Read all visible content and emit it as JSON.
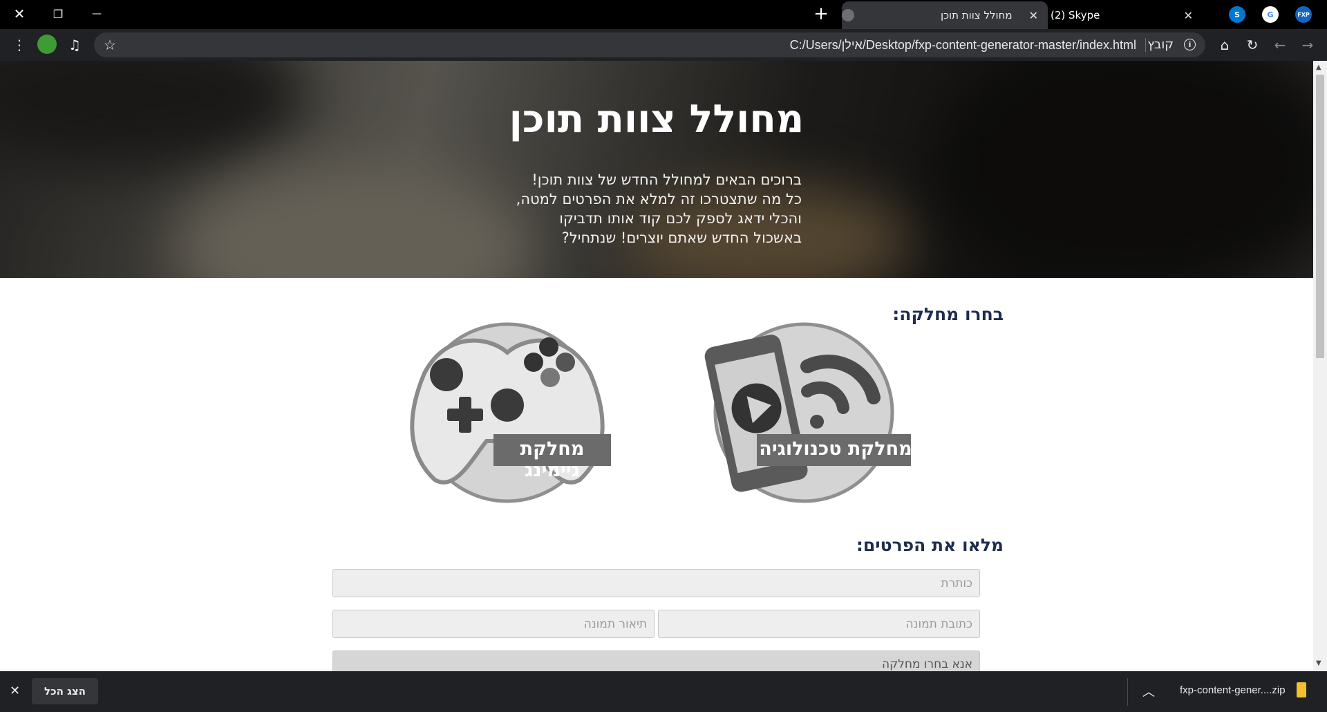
{
  "browser": {
    "tabs": [
      {
        "title": "מחולל צוות תוכן",
        "active": true
      },
      {
        "title": "(2) Skype",
        "active": false
      }
    ],
    "new_tab_label": "+",
    "window_controls": {
      "close": "✕",
      "restore": "❐",
      "minimize": "—"
    },
    "url": "C:/Users/אילן/Desktop/fxp-content-generator-master/index.html",
    "url_scheme_label": "קובץ",
    "pinned": {
      "google": "G",
      "fxp": "FXP"
    }
  },
  "hero": {
    "title": "מחולל צוות תוכן",
    "lines": [
      "ברוכים הבאים למחולל החדש של צוות תוכן!",
      "כל מה שתצטרכו זה למלא את הפרטים למטה,",
      "והכלי ידאג לספק לכם קוד אותו תדביקו",
      "באשכול החדש שאתם יוצרים! שנתחיל?"
    ]
  },
  "departments": {
    "heading": "בחרו מחלקה:",
    "items": [
      {
        "label": "מחלקת טכנולוגיה",
        "icon": "phone-wifi-icon"
      },
      {
        "label": "מחלקת גיימינג",
        "icon": "gamepad-icon"
      }
    ]
  },
  "form": {
    "heading": "מלאו את הפרטים:",
    "title_placeholder": "כותרת",
    "image_url_placeholder": "כתובת תמונה",
    "image_desc_placeholder": "תיאור תמונה",
    "department_placeholder": "אנא בחרו מחלקה"
  },
  "download_bar": {
    "file_name": "fxp-content-gener....zip",
    "show_all": "הצג הכל",
    "close": "✕"
  }
}
